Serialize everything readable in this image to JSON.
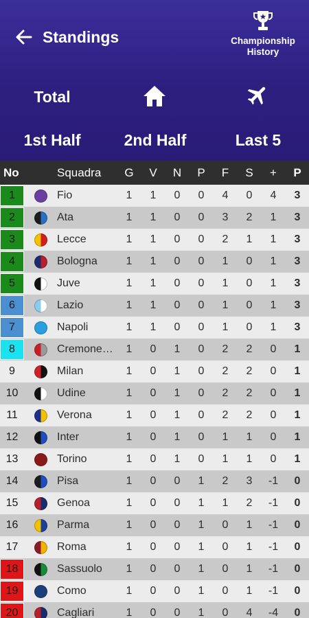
{
  "header": {
    "title": "Standings",
    "history_label_line1": "Championship",
    "history_label_line2": "History",
    "modes": {
      "total": "Total",
      "first_half": "1st Half",
      "second_half": "2nd Half",
      "last5": "Last 5"
    },
    "icons": {
      "back": "arrow-left-icon",
      "trophy": "trophy-icon",
      "home": "home-icon",
      "away": "airplane-icon"
    }
  },
  "table": {
    "headers": [
      "No",
      "Squadra",
      "G",
      "V",
      "N",
      "P",
      "F",
      "S",
      "+",
      "P"
    ],
    "rows": [
      {
        "no": "1",
        "team": "Fio",
        "g": "1",
        "v": "1",
        "n": "0",
        "p": "0",
        "f": "4",
        "s": "0",
        "diff": "4",
        "pts": "3",
        "zone": "#1a8a1a",
        "colors": [
          "#6b3fa0",
          "#6b3fa0"
        ]
      },
      {
        "no": "2",
        "team": "Ata",
        "g": "1",
        "v": "1",
        "n": "0",
        "p": "0",
        "f": "3",
        "s": "2",
        "diff": "1",
        "pts": "3",
        "zone": "#1a8a1a",
        "colors": [
          "#1c1c1c",
          "#2a6fc0"
        ]
      },
      {
        "no": "3",
        "team": "Lecce",
        "g": "1",
        "v": "1",
        "n": "0",
        "p": "0",
        "f": "2",
        "s": "1",
        "diff": "1",
        "pts": "3",
        "zone": "#1a8a1a",
        "colors": [
          "#f2c200",
          "#d11f1f"
        ]
      },
      {
        "no": "4",
        "team": "Bologna",
        "g": "1",
        "v": "1",
        "n": "0",
        "p": "0",
        "f": "1",
        "s": "0",
        "diff": "1",
        "pts": "3",
        "zone": "#1a8a1a",
        "colors": [
          "#1c2b6e",
          "#b5202a"
        ]
      },
      {
        "no": "5",
        "team": "Juve",
        "g": "1",
        "v": "1",
        "n": "0",
        "p": "0",
        "f": "1",
        "s": "0",
        "diff": "1",
        "pts": "3",
        "zone": "#1a8a1a",
        "colors": [
          "#111111",
          "#ffffff"
        ]
      },
      {
        "no": "6",
        "team": "Lazio",
        "g": "1",
        "v": "1",
        "n": "0",
        "p": "0",
        "f": "1",
        "s": "0",
        "diff": "1",
        "pts": "3",
        "zone": "#4a8fd0",
        "colors": [
          "#8ccbf0",
          "#ffffff"
        ]
      },
      {
        "no": "7",
        "team": "Napoli",
        "g": "1",
        "v": "1",
        "n": "0",
        "p": "0",
        "f": "1",
        "s": "0",
        "diff": "1",
        "pts": "3",
        "zone": "#4a8fd0",
        "colors": [
          "#2a9fe0",
          "#2a9fe0"
        ]
      },
      {
        "no": "8",
        "team": "Cremone…",
        "g": "1",
        "v": "0",
        "n": "1",
        "p": "0",
        "f": "2",
        "s": "2",
        "diff": "0",
        "pts": "1",
        "zone": "#19e3f0",
        "colors": [
          "#c8202a",
          "#9a9a9a"
        ]
      },
      {
        "no": "9",
        "team": "Milan",
        "g": "1",
        "v": "0",
        "n": "1",
        "p": "0",
        "f": "2",
        "s": "2",
        "diff": "0",
        "pts": "1",
        "zone": "",
        "colors": [
          "#d0202a",
          "#111111"
        ]
      },
      {
        "no": "10",
        "team": "Udine",
        "g": "1",
        "v": "0",
        "n": "1",
        "p": "0",
        "f": "2",
        "s": "2",
        "diff": "0",
        "pts": "1",
        "zone": "",
        "colors": [
          "#111111",
          "#ffffff"
        ]
      },
      {
        "no": "11",
        "team": "Verona",
        "g": "1",
        "v": "0",
        "n": "1",
        "p": "0",
        "f": "2",
        "s": "2",
        "diff": "0",
        "pts": "1",
        "zone": "",
        "colors": [
          "#1c2f8a",
          "#f2c200"
        ]
      },
      {
        "no": "12",
        "team": "Inter",
        "g": "1",
        "v": "0",
        "n": "1",
        "p": "0",
        "f": "1",
        "s": "1",
        "diff": "0",
        "pts": "1",
        "zone": "",
        "colors": [
          "#111111",
          "#1f4fbf"
        ]
      },
      {
        "no": "13",
        "team": "Torino",
        "g": "1",
        "v": "0",
        "n": "1",
        "p": "0",
        "f": "1",
        "s": "1",
        "diff": "0",
        "pts": "1",
        "zone": "",
        "colors": [
          "#8a1a1a",
          "#8a1a1a"
        ]
      },
      {
        "no": "14",
        "team": "Pisa",
        "g": "1",
        "v": "0",
        "n": "0",
        "p": "1",
        "f": "2",
        "s": "3",
        "diff": "-1",
        "pts": "0",
        "zone": "",
        "colors": [
          "#1c1c1c",
          "#1f4fbf"
        ]
      },
      {
        "no": "15",
        "team": "Genoa",
        "g": "1",
        "v": "0",
        "n": "0",
        "p": "1",
        "f": "1",
        "s": "2",
        "diff": "-1",
        "pts": "0",
        "zone": "",
        "colors": [
          "#b5202a",
          "#1c2b6e"
        ]
      },
      {
        "no": "16",
        "team": "Parma",
        "g": "1",
        "v": "0",
        "n": "0",
        "p": "1",
        "f": "0",
        "s": "1",
        "diff": "-1",
        "pts": "0",
        "zone": "",
        "colors": [
          "#f2c200",
          "#1c3f9a"
        ]
      },
      {
        "no": "17",
        "team": "Roma",
        "g": "1",
        "v": "0",
        "n": "0",
        "p": "1",
        "f": "0",
        "s": "1",
        "diff": "-1",
        "pts": "0",
        "zone": "",
        "colors": [
          "#8a1a2a",
          "#f2b200"
        ]
      },
      {
        "no": "18",
        "team": "Sassuolo",
        "g": "1",
        "v": "0",
        "n": "0",
        "p": "1",
        "f": "0",
        "s": "1",
        "diff": "-1",
        "pts": "0",
        "zone": "#e01515",
        "colors": [
          "#111111",
          "#1a8a3a"
        ]
      },
      {
        "no": "19",
        "team": "Como",
        "g": "1",
        "v": "0",
        "n": "0",
        "p": "1",
        "f": "0",
        "s": "1",
        "diff": "-1",
        "pts": "0",
        "zone": "#e01515",
        "colors": [
          "#1c3f7a",
          "#1c3f7a"
        ]
      },
      {
        "no": "20",
        "team": "Cagliari",
        "g": "1",
        "v": "0",
        "n": "0",
        "p": "1",
        "f": "0",
        "s": "4",
        "diff": "-4",
        "pts": "0",
        "zone": "#e01515",
        "colors": [
          "#b5202a",
          "#1c2b6e"
        ]
      }
    ]
  },
  "colors": {
    "header_top": "#3a2e9a",
    "header_bottom": "#2a1b78",
    "table_header": "#2f2f2f",
    "row_light": "#ececec",
    "row_dark": "#c9c9c9"
  }
}
